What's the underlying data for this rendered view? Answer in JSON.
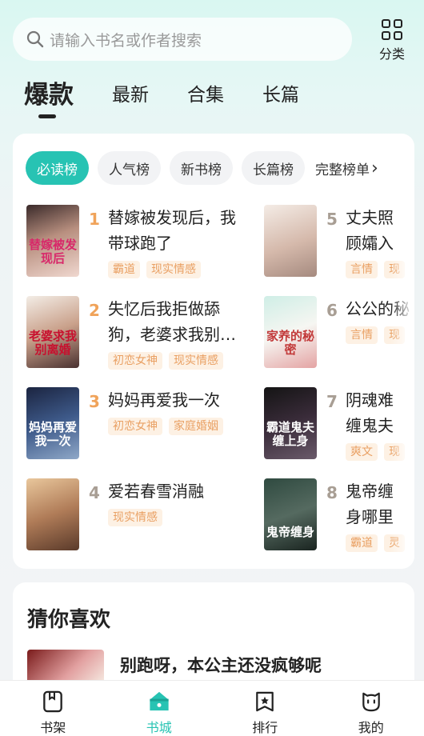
{
  "search": {
    "placeholder": "请输入书名或作者搜索"
  },
  "category_button": {
    "label": "分类"
  },
  "tabs": [
    {
      "label": "爆款",
      "active": true
    },
    {
      "label": "最新"
    },
    {
      "label": "合集"
    },
    {
      "label": "长篇"
    }
  ],
  "ranking": {
    "chips": [
      {
        "label": "必读榜",
        "active": true
      },
      {
        "label": "人气榜"
      },
      {
        "label": "新书榜"
      },
      {
        "label": "长篇榜"
      }
    ],
    "more_label": "完整榜单",
    "books": [
      {
        "rank": "1",
        "title": "替嫁被发现后，我带球跑了",
        "tags": [
          "霸道",
          "现实情感"
        ],
        "cover_text": "替嫁被发现后"
      },
      {
        "rank": "2",
        "title": "失忆后我拒做舔狗，老婆求我别…",
        "tags": [
          "初恋女神",
          "现实情感"
        ],
        "cover_text": "老婆求我别离婚"
      },
      {
        "rank": "3",
        "title": "妈妈再爱我一次",
        "tags": [
          "初恋女神",
          "家庭婚姻"
        ],
        "cover_text": "妈妈再爱我一次"
      },
      {
        "rank": "4",
        "title": "爱若春雪消融",
        "tags": [
          "现实情感"
        ],
        "cover_text": ""
      },
      {
        "rank": "5",
        "title": "丈夫照顾孀入戏",
        "tags": [
          "言情",
          "现"
        ],
        "cover_text": ""
      },
      {
        "rank": "6",
        "title": "公公的秘",
        "tags": [
          "言情",
          "现"
        ],
        "cover_text": "家养的秘密"
      },
      {
        "rank": "7",
        "title": "阴魂难缠鬼夫缠身",
        "tags": [
          "爽文",
          "现"
        ],
        "cover_text": "霸道鬼夫缠上身"
      },
      {
        "rank": "8",
        "title": "鬼帝缠身哪里逃",
        "tags": [
          "霸道",
          "灵"
        ],
        "cover_text": "鬼帝缠身"
      }
    ]
  },
  "guess": {
    "heading": "猜你喜欢",
    "first_title": "别跑呀，本公主还没疯够呢"
  },
  "nav": [
    {
      "label": "书架"
    },
    {
      "label": "书城",
      "active": true
    },
    {
      "label": "排行"
    },
    {
      "label": "我的"
    }
  ],
  "colors": {
    "accent": "#27c3b3",
    "rank_top": "#f0a35a",
    "tag_text": "#e9a063",
    "tag_bg": "#fdf1e4"
  }
}
